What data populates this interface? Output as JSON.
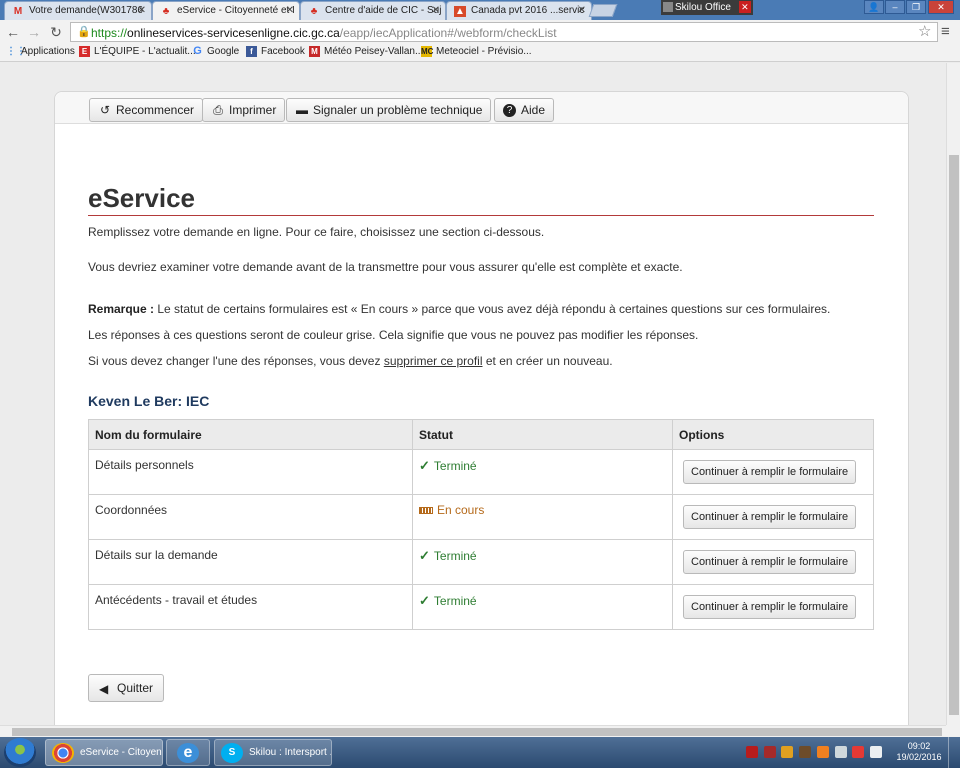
{
  "browser": {
    "tabs": [
      {
        "label": "Votre demande(W301786",
        "icon": "gmail-icon",
        "active": false
      },
      {
        "label": "eService - Citoyenneté et I",
        "icon": "maple-leaf-icon",
        "active": true
      },
      {
        "label": "Centre d'aide de CIC - Suj",
        "icon": "maple-leaf-icon",
        "active": false
      },
      {
        "label": "Canada pvt 2016 ...servic",
        "icon": "pvt-icon",
        "active": false
      }
    ],
    "profile_label": "Skilou Office",
    "url": {
      "scheme": "https://",
      "host": "onlineservices-servicesenligne.cic.gc.ca",
      "path": "/eapp/iecApplication#/webform/checkList"
    },
    "bookmarks": [
      {
        "label": "Applications",
        "icon": "apps-grid-icon",
        "color": "#4a90d9"
      },
      {
        "label": "L'ÉQUIPE - L'actualit...",
        "icon": "lequipe-icon",
        "color": "#d62b2b"
      },
      {
        "label": "Google",
        "icon": "google-icon",
        "color": "#4285f4"
      },
      {
        "label": "Facebook",
        "icon": "facebook-icon",
        "color": "#3b5998"
      },
      {
        "label": "Météo Peisey-Vallan...",
        "icon": "meteo-icon",
        "color": "#c62828"
      },
      {
        "label": "Meteociel - Prévisio...",
        "icon": "meteociel-icon",
        "color": "#e6b800"
      }
    ]
  },
  "toolbar": {
    "restart_label": "Recommencer",
    "print_label": "Imprimer",
    "report_label": "Signaler un problème technique",
    "help_label": "Aide"
  },
  "page": {
    "title": "eService",
    "intro": "Remplissez votre demande en ligne. Pour ce faire, choisissez une section ci-dessous.",
    "review": "Vous devriez examiner votre demande avant de la transmettre pour vous assurer qu'elle est complète et exacte.",
    "remark_label": "Remarque :",
    "remark_text": " Le statut de certains formulaires est « En cours » parce que vous avez déjà répondu à certaines questions sur ces formulaires.",
    "grey_note": "Les réponses à ces questions seront de couleur grise. Cela signifie que vous ne pouvez pas modifier les réponses.",
    "change_before": "Si vous devez changer l'une des réponses, vous devez ",
    "change_link": "supprimer ce profil",
    "change_after": " et en créer un nouveau.",
    "applicant": "Keven Le Ber: IEC",
    "quit_label": "Quitter"
  },
  "table": {
    "headers": [
      "Nom du formulaire",
      "Statut",
      "Options"
    ],
    "rows": [
      {
        "name": "Détails personnels",
        "status": "Terminé",
        "state": "done",
        "action": "Continuer à remplir le formulaire"
      },
      {
        "name": "Coordonnées",
        "status": "En cours",
        "state": "progress",
        "action": "Continuer à remplir le formulaire"
      },
      {
        "name": "Détails sur la demande",
        "status": "Terminé",
        "state": "done",
        "action": "Continuer à remplir le formulaire"
      },
      {
        "name": "Antécédents - travail et études",
        "status": "Terminé",
        "state": "done",
        "action": "Continuer à remplir le formulaire"
      }
    ]
  },
  "taskbar": {
    "tasks": [
      "eService - Citoyen...",
      "Skilou : Intersport ..."
    ],
    "time": "09:02",
    "date": "19/02/2016"
  }
}
